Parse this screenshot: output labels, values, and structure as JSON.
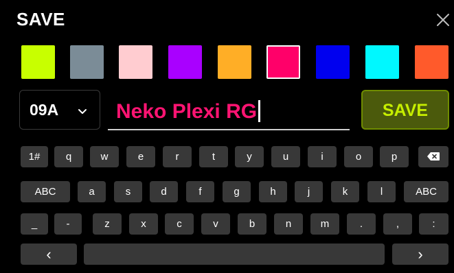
{
  "dialog": {
    "title": "SAVE"
  },
  "colors": [
    "#c8ff00",
    "#7b8c97",
    "#ffccd0",
    "#a900ff",
    "#ffae26",
    "#ff0069",
    "#0000ef",
    "#00f8ff",
    "#ff5a2b"
  ],
  "selected_color_index": 5,
  "bank": {
    "value": "09A"
  },
  "preset_name": {
    "value": "Neko Plexi RG",
    "color": "#ff1472"
  },
  "save_button": {
    "label": "SAVE",
    "accent": "#c6ee00"
  },
  "keyboard": {
    "row1": [
      "1#",
      "q",
      "w",
      "e",
      "r",
      "t",
      "y",
      "u",
      "i",
      "o",
      "p"
    ],
    "row2": [
      "ABC",
      "a",
      "s",
      "d",
      "f",
      "g",
      "h",
      "j",
      "k",
      "l",
      "ABC"
    ],
    "row3": [
      "_",
      "-",
      "z",
      "x",
      "c",
      "v",
      "b",
      "n",
      "m",
      ".",
      ",",
      ":"
    ],
    "left_arrow": "‹",
    "right_arrow": "›"
  }
}
